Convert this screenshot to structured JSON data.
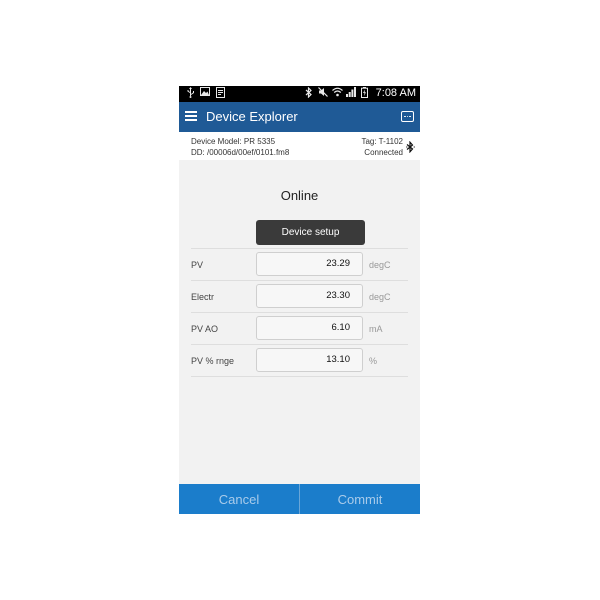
{
  "status_bar": {
    "time": "7:08 AM",
    "left_icons": [
      "usb-icon",
      "image-icon",
      "document-icon"
    ],
    "right_icons": [
      "bluetooth-icon",
      "mute-icon",
      "wifi-icon",
      "signal-icon",
      "battery-icon"
    ]
  },
  "app_bar": {
    "title": "Device Explorer",
    "menu_icon": "hamburger-menu-icon",
    "overflow_icon": "chat-bubble-icon"
  },
  "device_info": {
    "model_line": "Device Model:  PR 5335",
    "dd_line": "DD:  /00006d/00ef/0101.fm8",
    "tag_line": "Tag:  T-1102",
    "status": "Connected",
    "status_icon": "bluetooth-icon"
  },
  "main": {
    "status_heading": "Online",
    "setup_button_label": "Device setup",
    "rows": [
      {
        "label": "PV",
        "value": "23.29",
        "unit": "degC"
      },
      {
        "label": "Electr",
        "value": "23.30",
        "unit": "degC"
      },
      {
        "label": "PV AO",
        "value": "6.10",
        "unit": "mA"
      },
      {
        "label": "PV % rnge",
        "value": "13.10",
        "unit": "%"
      }
    ]
  },
  "bottom_bar": {
    "cancel_label": "Cancel",
    "commit_label": "Commit"
  },
  "colors": {
    "app_bar": "#1f5a96",
    "bottom_bar": "#1b7dcb",
    "button_dark": "#3a3a3a"
  }
}
